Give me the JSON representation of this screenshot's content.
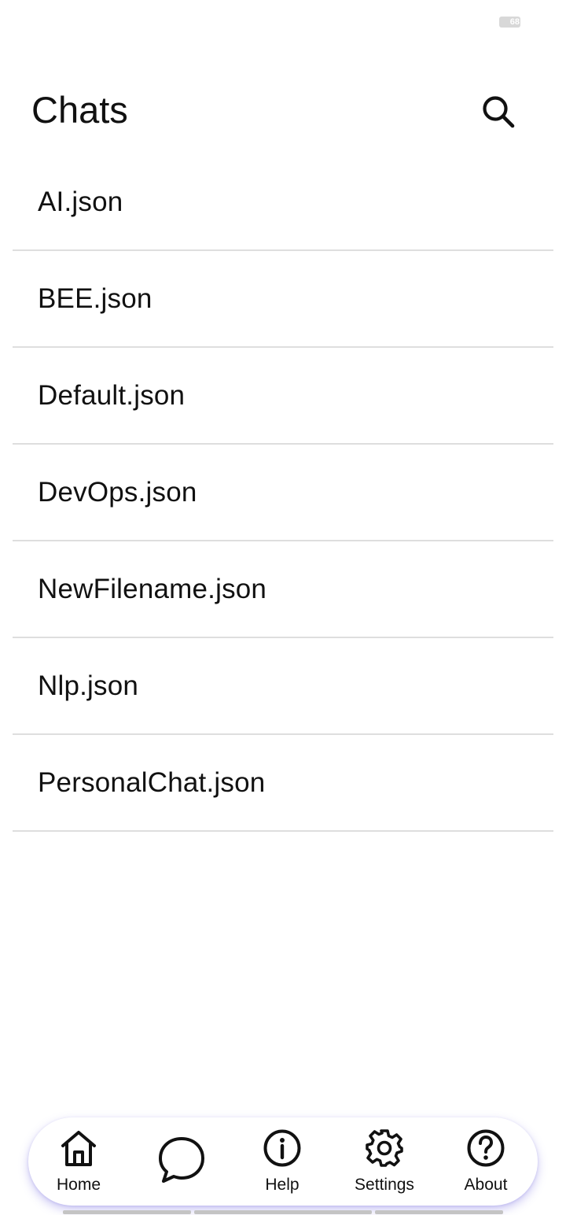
{
  "status_bar": {
    "battery_level": "68"
  },
  "header": {
    "title": "Chats",
    "search_icon": "search-icon"
  },
  "chats": [
    {
      "label": "AI.json"
    },
    {
      "label": "BEE.json"
    },
    {
      "label": "Default.json"
    },
    {
      "label": "DevOps.json"
    },
    {
      "label": "NewFilename.json"
    },
    {
      "label": "Nlp.json"
    },
    {
      "label": "PersonalChat.json"
    }
  ],
  "bottom_nav": {
    "accent_shadow": "#8c82e6",
    "items": [
      {
        "label": "Home",
        "icon": "home-icon"
      },
      {
        "label": "",
        "icon": "chat-bubble-icon"
      },
      {
        "label": "Help",
        "icon": "info-icon"
      },
      {
        "label": "Settings",
        "icon": "gear-icon"
      },
      {
        "label": "About",
        "icon": "question-icon"
      }
    ]
  }
}
